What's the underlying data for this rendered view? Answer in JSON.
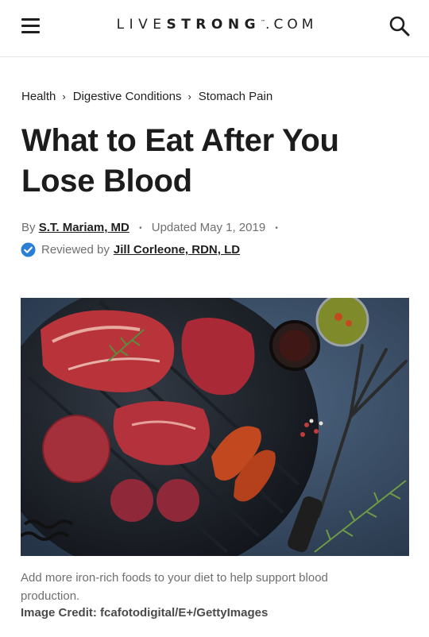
{
  "header": {
    "logo_pre": "LIVE",
    "logo_bold": "STRONG",
    "logo_tm": "™",
    "logo_com": ".COM"
  },
  "breadcrumb": {
    "items": [
      "Health",
      "Digestive Conditions",
      "Stomach Pain"
    ],
    "separator": "›"
  },
  "article": {
    "title": "What to Eat After You Lose Blood",
    "by_prefix": "By",
    "author": "S.T. Mariam, MD",
    "bullet": "•",
    "updated": "Updated May 1, 2019",
    "reviewed_prefix": "Reviewed by",
    "reviewer": "Jill Corleone, RDN, LD",
    "caption": "Add more iron-rich foods to your diet to help support blood production.",
    "image_credit": "Image Credit: fcafotodigital/E+/GettyImages"
  },
  "icons": {
    "menu": "hamburger-menu-icon",
    "search": "search-icon",
    "verified": "checkmark-badge-icon"
  },
  "colors": {
    "text": "#1f1f1f",
    "muted": "#6f6f6f",
    "verified_badge": "#2a7fd4"
  }
}
